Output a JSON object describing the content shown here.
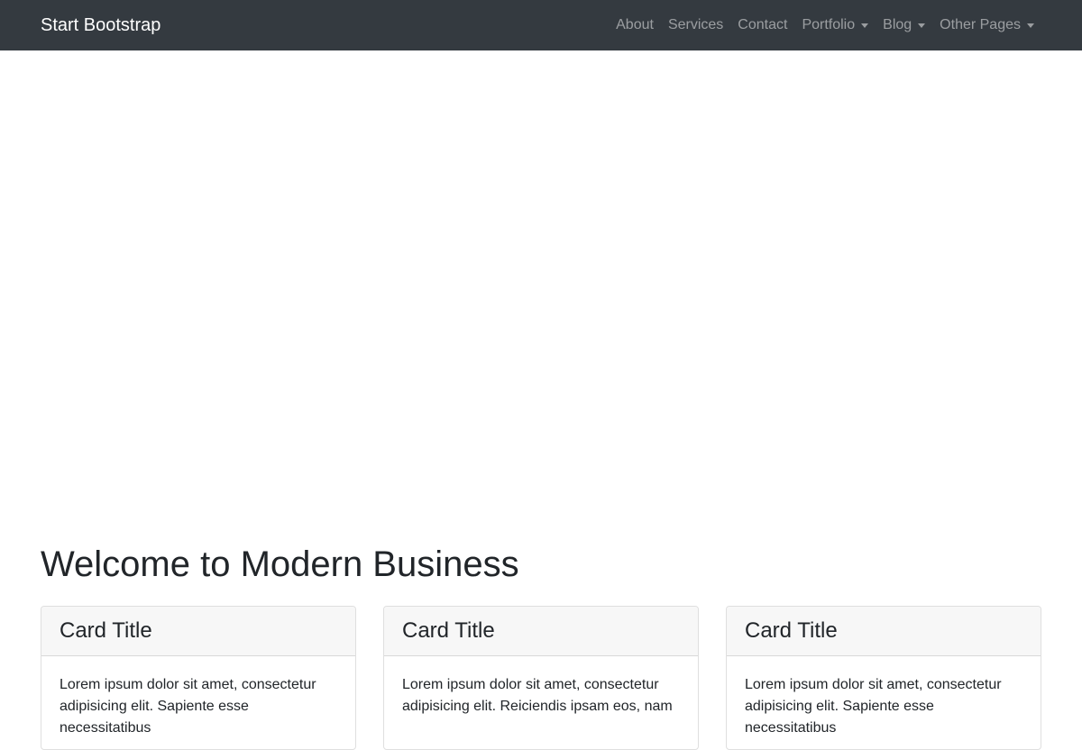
{
  "navbar": {
    "brand": "Start Bootstrap",
    "items": [
      {
        "label": "About",
        "dropdown": false
      },
      {
        "label": "Services",
        "dropdown": false
      },
      {
        "label": "Contact",
        "dropdown": false
      },
      {
        "label": "Portfolio",
        "dropdown": true
      },
      {
        "label": "Blog",
        "dropdown": true
      },
      {
        "label": "Other Pages",
        "dropdown": true
      }
    ]
  },
  "main": {
    "title": "Welcome to Modern Business",
    "cards": [
      {
        "title": "Card Title",
        "text": "Lorem ipsum dolor sit amet, consectetur adipisicing elit. Sapiente esse necessitatibus"
      },
      {
        "title": "Card Title",
        "text": "Lorem ipsum dolor sit amet, consectetur adipisicing elit. Reiciendis ipsam eos, nam"
      },
      {
        "title": "Card Title",
        "text": "Lorem ipsum dolor sit amet, consectetur adipisicing elit. Sapiente esse necessitatibus"
      }
    ]
  },
  "colors": {
    "navbar_bg": "#343a40",
    "card_header_bg": "#f7f7f7",
    "text": "#212529"
  }
}
